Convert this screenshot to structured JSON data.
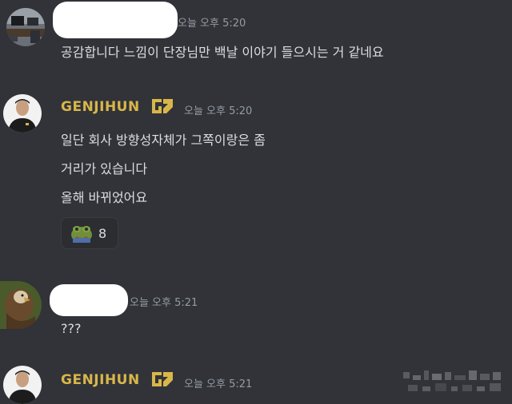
{
  "messages": [
    {
      "author": "",
      "time": "오늘 오후 5:20",
      "lines": [
        "공감합니다 느낌이 단장님만 백날 이야기 들으시는 거 같네요"
      ]
    },
    {
      "author": "GENJIHUN",
      "time": "오늘 오후 5:20",
      "lines": [
        "일단 회사 방향성자체가 그쪽이랑은 좀",
        "거리가 있습니다",
        "올해 바뀌었어요"
      ],
      "reaction": {
        "emoji": "pepe-frog-emoji",
        "count": "8"
      }
    },
    {
      "author": "",
      "time": "오늘 오후 5:21",
      "lines": [
        "???"
      ]
    },
    {
      "author": "GENJIHUN",
      "time": "오늘 오후 5:21",
      "lines": []
    }
  ],
  "colors": {
    "background": "#313338",
    "author_gold": "#d9b64a",
    "timestamp": "#949ba4",
    "text": "#dbdee1"
  }
}
